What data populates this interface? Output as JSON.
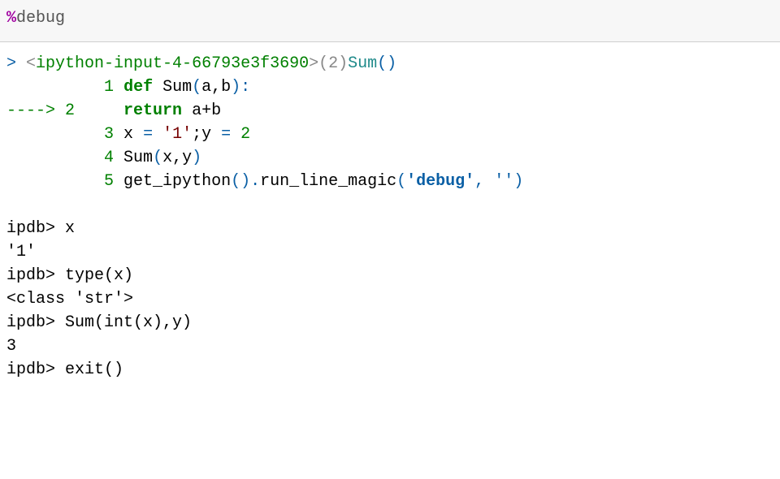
{
  "input": {
    "percent": "%",
    "cmd": "debug"
  },
  "header": {
    "gt": "> ",
    "lt": "<",
    "module": "ipython-input-4-66793e3f3690",
    "gt2": ">",
    "lineref": "(2)",
    "func": "Sum",
    "parens": "()"
  },
  "code": {
    "pad1": "          ",
    "n1": "1",
    "sp1": " ",
    "def": "def",
    "funcname": " Sum",
    "paren_open": "(",
    "args": "a,b",
    "paren_close": ")",
    "colon": ":",
    "arrow": "----> ",
    "n2": "2",
    "indent2": "     ",
    "return": "return",
    "expr2": " a+b",
    "n3": "3",
    "sp3": " x ",
    "eq3a": "=",
    "str3": " '1'",
    "semi3": ";y ",
    "eq3b": "=",
    "num3": " 2",
    "n4": "4",
    "sp4": " Sum",
    "p4o": "(",
    "args4": "x,y",
    "p4c": ")",
    "n5": "5",
    "sp5": " get_ipython",
    "p5a": "()",
    "dot5": ".",
    "run5": "run_line_magic",
    "p5b": "(",
    "str5a": "'debug'",
    "comma5": ", ",
    "str5b": "''",
    "p5c": ")"
  },
  "session": {
    "prompt": "ipdb> ",
    "cmd1": "x",
    "out1": "'1'",
    "cmd2": "type(x)",
    "out2": "<class 'str'>",
    "cmd3": "Sum(int(x),y)",
    "out3": "3",
    "cmd4": "exit()"
  }
}
